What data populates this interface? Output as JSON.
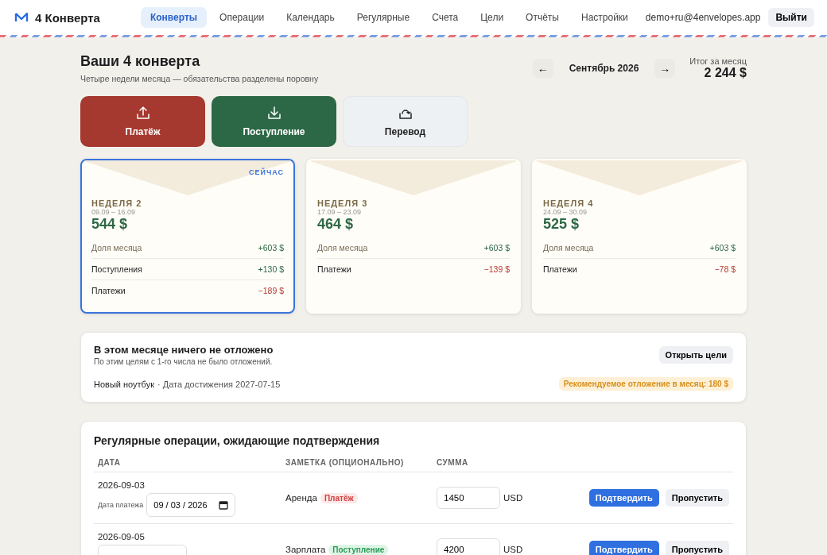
{
  "brand": {
    "name": "4 Конверта"
  },
  "nav": [
    {
      "label": "Конверты",
      "selected": true
    },
    {
      "label": "Операции",
      "selected": false
    },
    {
      "label": "Календарь",
      "selected": false
    },
    {
      "label": "Регулярные",
      "selected": false
    },
    {
      "label": "Счета",
      "selected": false
    },
    {
      "label": "Цели",
      "selected": false
    },
    {
      "label": "Отчёты",
      "selected": false
    },
    {
      "label": "Настройки",
      "selected": false
    }
  ],
  "user": {
    "email": "demo+ru@4envelopes.app",
    "logout": "Выйти"
  },
  "header": {
    "title": "Ваши 4 конверта",
    "subtitle": "Четыре недели месяца — обязательства разделены поровну",
    "prev": "←",
    "month": "Сентябрь 2026",
    "next": "→",
    "total_label": "Итог за месяц",
    "total": "2 244 $"
  },
  "actions": [
    {
      "kind": "payment",
      "label": "Платёж"
    },
    {
      "kind": "income",
      "label": "Поступление"
    },
    {
      "kind": "transfer",
      "label": "Перевод"
    }
  ],
  "weeks": [
    {
      "current": true,
      "badge": "СЕЙЧАС",
      "title": "НЕДЕЛЯ 2",
      "dates": "09.09 – 16.09",
      "amount": "544 $",
      "rows": [
        {
          "kind": "share",
          "label": "Доля месяца",
          "value": "+603 $"
        },
        {
          "kind": "income",
          "label": "Поступления",
          "value": "+130 $"
        },
        {
          "kind": "payment",
          "label": "Платежи",
          "value": "−189 $"
        }
      ]
    },
    {
      "current": false,
      "title": "НЕДЕЛЯ 3",
      "dates": "17.09 – 23.09",
      "amount": "464 $",
      "rows": [
        {
          "kind": "share",
          "label": "Доля месяца",
          "value": "+603 $"
        },
        {
          "kind": "payment",
          "label": "Платежи",
          "value": "−139 $"
        }
      ]
    },
    {
      "current": false,
      "title": "НЕДЕЛЯ 4",
      "dates": "24.09 – 30.09",
      "amount": "525 $",
      "rows": [
        {
          "kind": "share",
          "label": "Доля месяца",
          "value": "+603 $"
        },
        {
          "kind": "payment",
          "label": "Платежи",
          "value": "−78 $"
        }
      ]
    }
  ],
  "goals": {
    "title": "В этом месяце ничего не отложено",
    "subtitle": "По этим целям с 1-го числа не было отложений.",
    "button": "Открыть цели",
    "goal_name": "Новый ноутбук",
    "goal_date": "· Дата достижения 2027-07-15",
    "recommendation": "Рекомендуемое отложение в месяц: 180 $"
  },
  "recurring": {
    "title": "Регулярные операции, ожидающие подтверждения",
    "columns": [
      "ДАТА",
      "ЗАМЕТКА (ОПЦИОНАЛЬНО)",
      "СУММА"
    ],
    "rows": [
      {
        "date": "2026-09-03",
        "date_label": "Дата платежа",
        "date_value": "09 / 03 / 2026",
        "note": "Аренда",
        "tag": {
          "kind": "payment",
          "label": "Платёж"
        },
        "amount": "1450",
        "currency": "USD",
        "confirm": "Подтвердить",
        "skip": "Пропустить"
      },
      {
        "date": "2026-09-05",
        "note": "Зарплата",
        "tag": {
          "kind": "income",
          "label": "Поступление"
        },
        "amount": "4200",
        "currency": "USD",
        "confirm": "Подтвердить",
        "skip": "Пропустить"
      }
    ]
  }
}
